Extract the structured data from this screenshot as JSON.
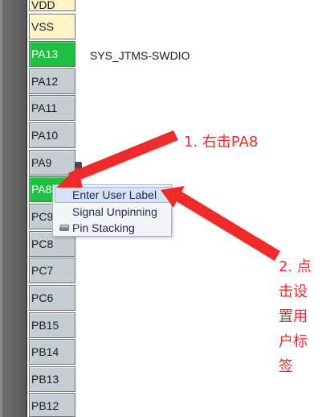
{
  "pins": [
    {
      "label": "VDD",
      "state": "power"
    },
    {
      "label": "VSS",
      "state": "power"
    },
    {
      "label": "PA13",
      "state": "assigned",
      "signal": "SYS_JTMS-SWDIO"
    },
    {
      "label": "PA12",
      "state": "free"
    },
    {
      "label": "PA11",
      "state": "free"
    },
    {
      "label": "PA10",
      "state": "free"
    },
    {
      "label": "PA9",
      "state": "free"
    },
    {
      "label": "PA8",
      "state": "assigned"
    },
    {
      "label": "PC9",
      "state": "free"
    },
    {
      "label": "PC8",
      "state": "free"
    },
    {
      "label": "PC7",
      "state": "free"
    },
    {
      "label": "PC6",
      "state": "free"
    },
    {
      "label": "PB15",
      "state": "free"
    },
    {
      "label": "PB14",
      "state": "free"
    },
    {
      "label": "PB13",
      "state": "free"
    },
    {
      "label": "PB12",
      "state": "free"
    }
  ],
  "context_menu": {
    "items": [
      {
        "label": "Enter User Label",
        "highlighted": true
      },
      {
        "label": "Signal Unpinning"
      },
      {
        "label": "Pin Stacking",
        "icon": "stack-icon"
      }
    ]
  },
  "annotations": {
    "step1": "1. 右击PA8",
    "step2_lines": [
      "2. 点",
      "击设",
      "置用",
      "户标",
      "签"
    ],
    "color": "#ee2a2a"
  },
  "colors": {
    "assigned_pin": "#1fbf44",
    "power_pin": "#fff5c8",
    "free_pin": "#c6ccd3",
    "chip_body": "#666666"
  }
}
